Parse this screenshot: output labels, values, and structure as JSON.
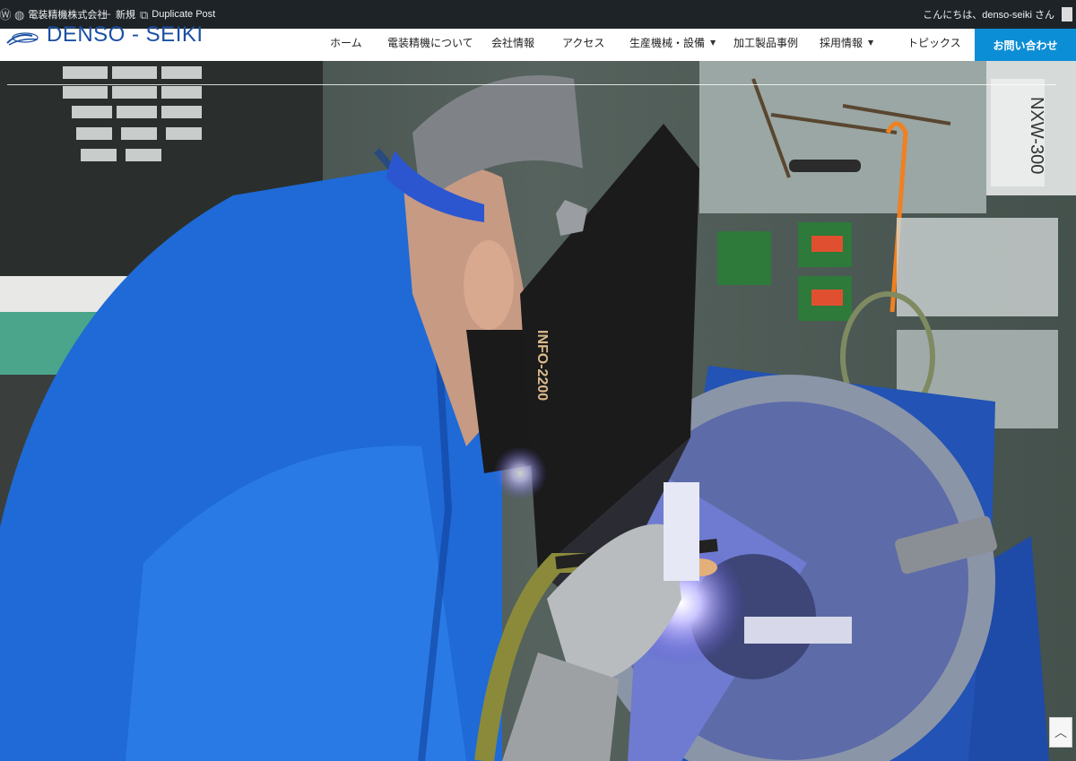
{
  "admin_bar": {
    "site_name": "電装精機株式会社",
    "new_label": "新規",
    "duplicate_label": "Duplicate Post",
    "greeting": "こんにちは、denso-seiki さん"
  },
  "header": {
    "logo_text": "DENSO - SEIKI",
    "nav": [
      {
        "label": "ホーム",
        "dropdown": false
      },
      {
        "label": "電装精機について",
        "dropdown": false
      },
      {
        "label": "会社情報",
        "dropdown": false
      },
      {
        "label": "アクセス",
        "dropdown": false
      },
      {
        "label": "生産機械・設備",
        "dropdown": true
      },
      {
        "label": "加工製品事例",
        "dropdown": false
      },
      {
        "label": "採用情報",
        "dropdown": true
      },
      {
        "label": "トピックス",
        "dropdown": false
      }
    ],
    "contact_label": "お問い合わせ"
  },
  "hero": {
    "helmet_text": "INFO-2200",
    "box_label": "NXW-300"
  },
  "colors": {
    "admin_bar": "#1d2327",
    "contact_button": "#0b8ed6",
    "brand_blue": "#1a4fa3"
  },
  "icons": {
    "wordpress": "wordpress-icon",
    "site": "dashboard-icon",
    "new": "plus-icon",
    "duplicate": "duplicate-icon",
    "scroll_top": "chevron-up-icon"
  }
}
